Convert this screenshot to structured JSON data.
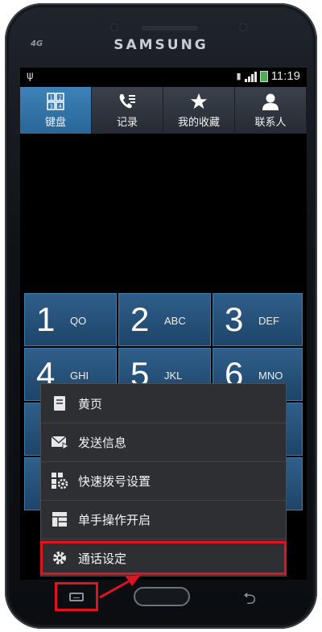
{
  "device": {
    "brand": "SAMSUNG",
    "network": "4G"
  },
  "status_bar": {
    "time": "11:19"
  },
  "tabs": [
    {
      "label": "键盘",
      "icon": "keypad-icon",
      "active": true
    },
    {
      "label": "记录",
      "icon": "call-log-icon",
      "active": false
    },
    {
      "label": "我的收藏",
      "icon": "star-icon",
      "active": false
    },
    {
      "label": "联系人",
      "icon": "contact-icon",
      "active": false
    }
  ],
  "keypad": [
    {
      "digit": "1",
      "letters": "QO"
    },
    {
      "digit": "2",
      "letters": "ABC"
    },
    {
      "digit": "3",
      "letters": "DEF"
    },
    {
      "digit": "4",
      "letters": "GHI"
    },
    {
      "digit": "5",
      "letters": "JKL"
    },
    {
      "digit": "6",
      "letters": "MNO"
    }
  ],
  "menu": {
    "items": [
      {
        "label": "黄页",
        "icon": "yellow-pages-icon"
      },
      {
        "label": "发送信息",
        "icon": "send-message-icon"
      },
      {
        "label": "快速拨号设置",
        "icon": "speed-dial-icon"
      },
      {
        "label": "单手操作开启",
        "icon": "one-hand-icon"
      },
      {
        "label": "通话设定",
        "icon": "gear-icon"
      }
    ]
  },
  "annotation": {
    "color": "#e0141e"
  },
  "colors": {
    "tab_active": "#3d82b8",
    "key_bg": "#2f5f8a",
    "menu_bg": "#2d2f33"
  }
}
